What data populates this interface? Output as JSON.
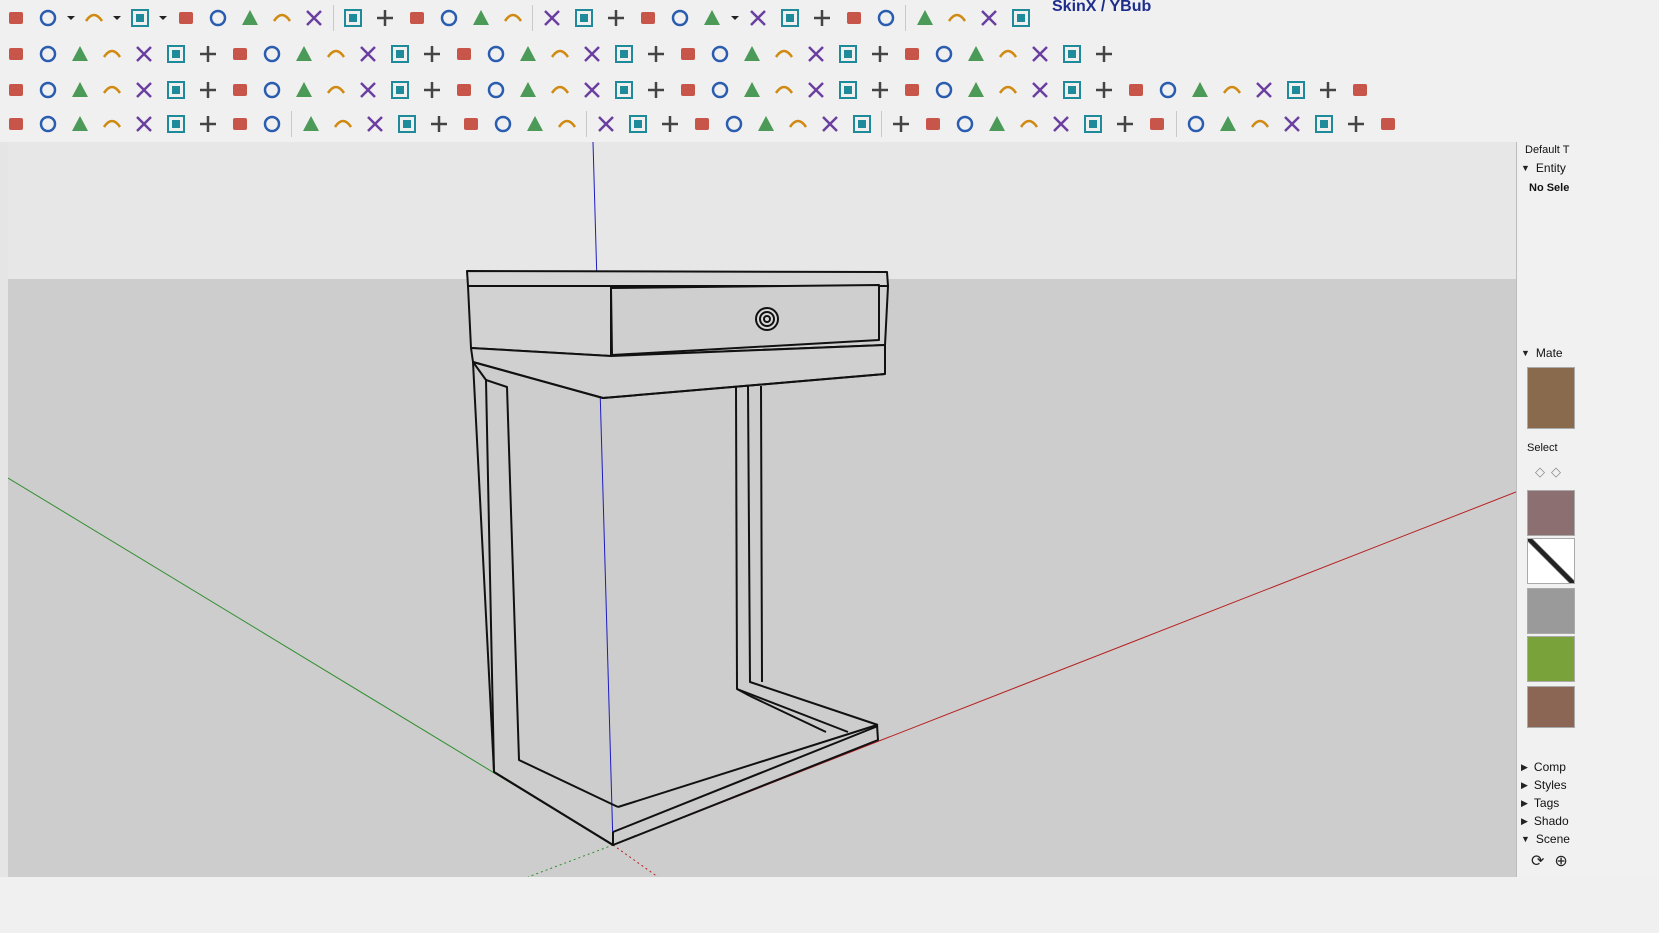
{
  "toolbar": {
    "skin_label": "SkinX / YBub",
    "row1": [
      "eraser",
      "pencil",
      "dropdown",
      "arc",
      "dropdown",
      "circle",
      "dropdown",
      "push-pull",
      "follow-me",
      "move",
      "rotate",
      "scale",
      "tape-measure",
      "text",
      "paint",
      "orbit",
      "pan",
      "zoom",
      "zoom-extents",
      "section-plane",
      "section-cuts",
      "section-fill",
      "sandbox",
      "user",
      "dropdown",
      "map",
      "tag",
      "solid-union",
      "solid-subtract",
      "solid-intersect",
      "solid-split",
      "skinx-1",
      "skinx-2",
      "skinx-3",
      "play",
      "stop",
      "help"
    ],
    "row2": [
      "select",
      "polyline",
      "softener",
      "trim",
      "weld",
      "edge-tools",
      "curve",
      "loft",
      "shell",
      "extrude",
      "fillet",
      "chamfer",
      "corner",
      "round-edge",
      "roof",
      "flat-roof",
      "stairs",
      "truss",
      "rafter",
      "joist",
      "framing",
      "sheathing",
      "wall",
      "siding",
      "panel",
      "railing",
      "deck",
      "fence",
      "shingle",
      "floor",
      "beam",
      "lattice",
      "lumber",
      "timber",
      "house"
    ],
    "row3": [
      "plane",
      "slab",
      "wide-slab",
      "red-slab",
      "grid",
      "spiral",
      "brick",
      "panel",
      "door",
      "cabinet",
      "link",
      "bracket",
      "dots",
      "cross",
      "plus",
      "star-cross",
      "pyramid",
      "cone",
      "tent",
      "hook",
      "pinwheel",
      "swirl",
      "compass",
      "box",
      "magnet",
      "shape-a",
      "shape-b",
      "shape-c",
      "gem",
      "pattern",
      "frame",
      "tile-a",
      "tile-b",
      "scatter",
      "curve-pts",
      "grid-pts",
      "line-tool",
      "measure",
      "paint-bucket",
      "hammer",
      "bulb",
      "ruler",
      "balance"
    ],
    "row4": [
      "bezier",
      "spline",
      "zigzag",
      "wave",
      "curve-s",
      "arc-2",
      "square",
      "spiral-2",
      "arc-3",
      "freehand",
      "hook-2",
      "hook-3",
      "arc-4",
      "polyline-2",
      "octagon",
      "wrench",
      "circle-2",
      "tri",
      "terrain",
      "map-2",
      "select-arrow",
      "scale-up",
      "scale-down",
      "lines-a",
      "lines-b",
      "lines-c",
      "dash-a",
      "dash-b",
      "dash-c",
      "grid-a",
      "grid-b",
      "grid-c",
      "grid-d",
      "grid-e",
      "grid-f",
      "grid-g",
      "grid-h",
      "grid-i",
      "checker",
      "copy",
      "flip",
      "align",
      "window"
    ]
  },
  "tray": {
    "title": "Default T",
    "entity_header": "Entity",
    "entity_status": "No Sele",
    "materials_header": "Mate",
    "select_tab": "Select",
    "components_header": "Comp",
    "styles_header": "Styles",
    "tags_header": "Tags",
    "shadows_header": "Shado",
    "scenes_header": "Scene",
    "swatch_colors": [
      "#8a6a4c",
      "#8c6f70",
      "#ffffff",
      "#9a9a9a",
      "#7aa23a",
      "#8b6655"
    ]
  },
  "colors": {
    "sky": "#e7e7e7",
    "ground": "#cecdcd",
    "axis_red": "#b52020",
    "axis_green": "#2f8f2f",
    "axis_blue": "#1c1cc0",
    "toolbar_bg": "#f0f0f0"
  }
}
